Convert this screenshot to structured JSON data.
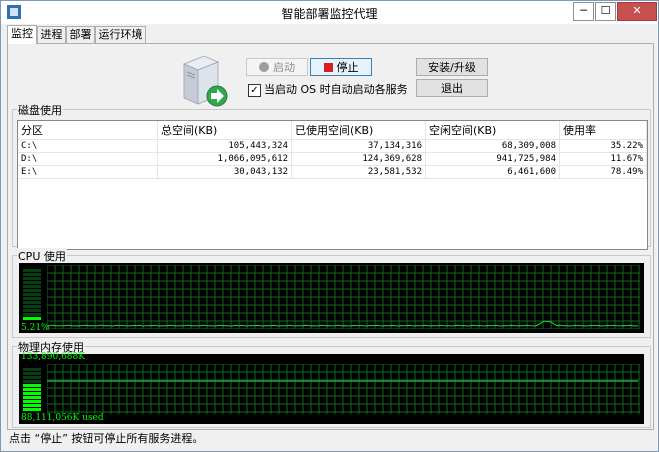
{
  "window": {
    "title": "智能部署监控代理",
    "min_label": "─",
    "max_label": "☐",
    "close_label": "✕"
  },
  "tabs": [
    {
      "label": "监控"
    },
    {
      "label": "进程"
    },
    {
      "label": "部署"
    },
    {
      "label": "运行环境"
    }
  ],
  "controls": {
    "start_label": "启动",
    "stop_label": "停止",
    "install_label": "安装/升级",
    "exit_label": "退出",
    "autostart_checked": true,
    "autostart_label": "当启动 OS 时自动启动各服务",
    "check_mark": "✓"
  },
  "disk": {
    "group_label": "磁盘使用",
    "headers": [
      "分区",
      "总空间(KB)",
      "已使用空间(KB)",
      "空闲空间(KB)",
      "使用率"
    ],
    "rows": [
      [
        "C:\\",
        "105,443,324",
        "37,134,316",
        "68,309,008",
        "35.22%"
      ],
      [
        "D:\\",
        "1,066,095,612",
        "124,369,628",
        "941,725,984",
        "11.67%"
      ],
      [
        "E:\\",
        "30,043,132",
        "23,581,532",
        "6,461,600",
        "78.49%"
      ]
    ]
  },
  "cpu": {
    "group_label": "CPU 使用",
    "value_text": "5.21%",
    "level": 0.0521
  },
  "memory": {
    "group_label": "物理内存使用",
    "total_text": "133,890,688K",
    "used_text": "88,111,056K used",
    "level": 0.658
  },
  "status": {
    "text": "点击 “停止” 按钮可停止所有服务进程。"
  },
  "colors": {
    "meter_green": "#00ff00",
    "grid_green": "#0a6e1e",
    "meter_bg": "#000000"
  }
}
